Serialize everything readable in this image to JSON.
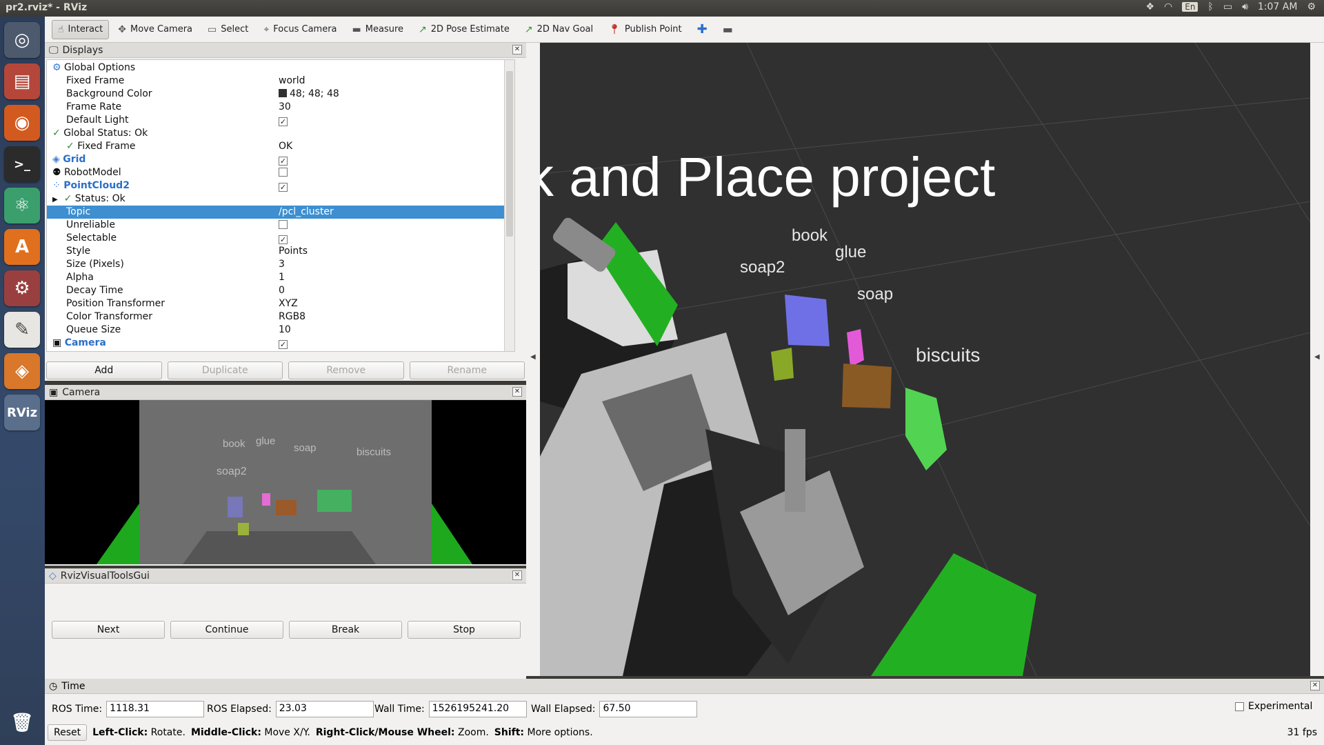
{
  "window": {
    "title": "pr2.rviz* - RViz"
  },
  "system_tray": {
    "lang": "En",
    "clock": "1:07 AM"
  },
  "launcher": {
    "rviz_label": "RViz"
  },
  "toolbar": {
    "interact": "Interact",
    "move_camera": "Move Camera",
    "select": "Select",
    "focus_camera": "Focus Camera",
    "measure": "Measure",
    "pose_estimate": "2D Pose Estimate",
    "nav_goal": "2D Nav Goal",
    "publish_point": "Publish Point"
  },
  "displays": {
    "title": "Displays",
    "rows": [
      {
        "k": "Global Options",
        "v": ""
      },
      {
        "k": "Fixed Frame",
        "v": "world"
      },
      {
        "k": "Background Color",
        "v": "48; 48; 48"
      },
      {
        "k": "Frame Rate",
        "v": "30"
      },
      {
        "k": "Default Light",
        "v": ""
      },
      {
        "k": "Global Status: Ok",
        "v": ""
      },
      {
        "k": "Fixed Frame",
        "v": "OK"
      },
      {
        "k": "Grid",
        "v": ""
      },
      {
        "k": "RobotModel",
        "v": ""
      },
      {
        "k": "PointCloud2",
        "v": ""
      },
      {
        "k": "Status: Ok",
        "v": ""
      },
      {
        "k": "Topic",
        "v": "/pcl_cluster"
      },
      {
        "k": "Unreliable",
        "v": ""
      },
      {
        "k": "Selectable",
        "v": ""
      },
      {
        "k": "Style",
        "v": "Points"
      },
      {
        "k": "Size (Pixels)",
        "v": "3"
      },
      {
        "k": "Alpha",
        "v": "1"
      },
      {
        "k": "Decay Time",
        "v": "0"
      },
      {
        "k": "Position Transformer",
        "v": "XYZ"
      },
      {
        "k": "Color Transformer",
        "v": "RGB8"
      },
      {
        "k": "Queue Size",
        "v": "10"
      },
      {
        "k": "Camera",
        "v": ""
      }
    ],
    "buttons": {
      "add": "Add",
      "duplicate": "Duplicate",
      "remove": "Remove",
      "rename": "Rename"
    }
  },
  "camera": {
    "title": "Camera",
    "labels": {
      "book": "book",
      "glue": "glue",
      "soap": "soap",
      "biscuits": "biscuits",
      "soap2": "soap2"
    }
  },
  "rvt": {
    "title": "RvizVisualToolsGui",
    "buttons": {
      "next": "Next",
      "continue": "Continue",
      "break": "Break",
      "stop": "Stop"
    }
  },
  "view3d": {
    "banner": "k  and  Place  project",
    "labels": {
      "book": "book",
      "glue": "glue",
      "soap2": "soap2",
      "soap": "soap",
      "biscuits": "biscuits"
    }
  },
  "time": {
    "title": "Time",
    "ros_time_label": "ROS Time:",
    "ros_time": "1118.31",
    "ros_elapsed_label": "ROS Elapsed:",
    "ros_elapsed": "23.03",
    "wall_time_label": "Wall Time:",
    "wall_time": "1526195241.20",
    "wall_elapsed_label": "Wall Elapsed:",
    "wall_elapsed": "67.50",
    "experimental": "Experimental",
    "reset": "Reset",
    "hint": {
      "left_click": "Left-Click:",
      "left_desc": "Rotate.",
      "middle_click": "Middle-Click:",
      "middle_desc": "Move X/Y.",
      "right_click": "Right-Click/Mouse Wheel:",
      "right_desc": "Zoom.",
      "shift": "Shift:",
      "shift_desc": "More options."
    },
    "fps": "31 fps"
  }
}
